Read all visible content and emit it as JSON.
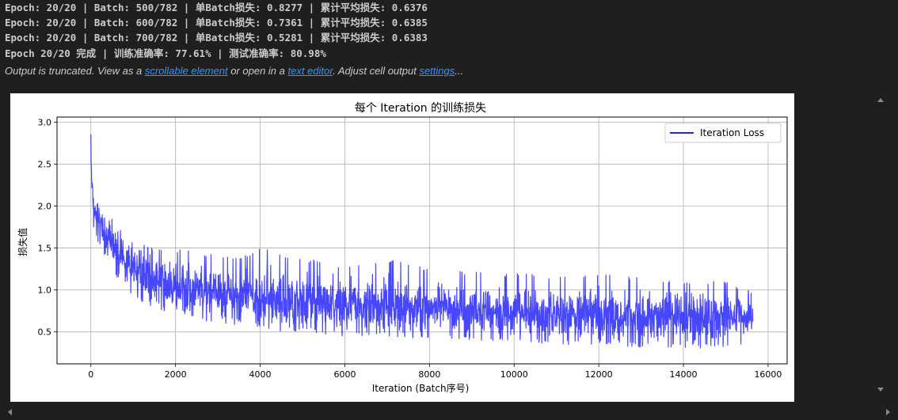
{
  "output_lines": [
    "Epoch: 20/20 | Batch: 500/782 | 单Batch损失: 0.8277 | 累计平均损失: 0.6376",
    "Epoch: 20/20 | Batch: 600/782 | 单Batch损失: 0.7361 | 累计平均损失: 0.6385",
    "Epoch: 20/20 | Batch: 700/782 | 单Batch损失: 0.5281 | 累计平均损失: 0.6383",
    "Epoch 20/20 完成 | 训练准确率: 77.61% | 测试准确率: 80.98%"
  ],
  "truncation": {
    "prefix": "Output is truncated. View as a ",
    "link1": "scrollable element",
    "middle": " or open in a ",
    "link2": "text editor",
    "middle2": ". Adjust cell output ",
    "link3": "settings",
    "suffix": "..."
  },
  "colors": {
    "background": "#1f1f1f",
    "text": "#cccccc",
    "link": "#3794ff",
    "series": "#0000ff"
  },
  "chart_data": {
    "type": "line",
    "title": "每个 Iteration 的训练损失",
    "xlabel": "Iteration (Batch序号)",
    "ylabel": "损失值",
    "xlim": [
      -800,
      16450
    ],
    "ylim": [
      0.12,
      3.06
    ],
    "xticks": [
      0,
      2000,
      4000,
      6000,
      8000,
      10000,
      12000,
      14000,
      16000
    ],
    "yticks": [
      0.5,
      1.0,
      1.5,
      2.0,
      2.5,
      3.0
    ],
    "ytick_labels": [
      "0.5",
      "1.0",
      "1.5",
      "2.0",
      "2.5",
      "3.0"
    ],
    "grid": true,
    "legend": "top-right",
    "series": [
      {
        "name": "Iteration Loss",
        "color": "#0000ff",
        "x": [
          0,
          20,
          60,
          150,
          300,
          500,
          800,
          1200,
          1600,
          2000,
          2500,
          3000,
          3500,
          4000,
          5000,
          6000,
          7000,
          8000,
          9000,
          10000,
          11000,
          12000,
          13000,
          14000,
          15000,
          15640
        ],
        "y_mean": [
          2.6,
          2.25,
          2.0,
          1.85,
          1.7,
          1.55,
          1.35,
          1.2,
          1.1,
          1.02,
          0.98,
          0.95,
          0.92,
          0.9,
          0.86,
          0.83,
          0.8,
          0.78,
          0.75,
          0.73,
          0.71,
          0.7,
          0.69,
          0.68,
          0.67,
          0.66
        ],
        "y_max": [
          2.9,
          2.4,
          2.2,
          2.05,
          1.95,
          1.85,
          1.65,
          1.55,
          1.5,
          1.5,
          1.45,
          1.42,
          1.4,
          1.5,
          1.38,
          1.3,
          1.38,
          1.25,
          1.22,
          1.2,
          1.18,
          1.2,
          1.15,
          1.12,
          1.1,
          1.0
        ],
        "y_min": [
          2.3,
          2.0,
          1.75,
          1.6,
          1.4,
          1.25,
          1.0,
          0.85,
          0.75,
          0.7,
          0.65,
          0.6,
          0.58,
          0.55,
          0.5,
          0.45,
          0.45,
          0.42,
          0.4,
          0.38,
          0.35,
          0.35,
          0.32,
          0.3,
          0.32,
          0.38
        ]
      }
    ]
  }
}
